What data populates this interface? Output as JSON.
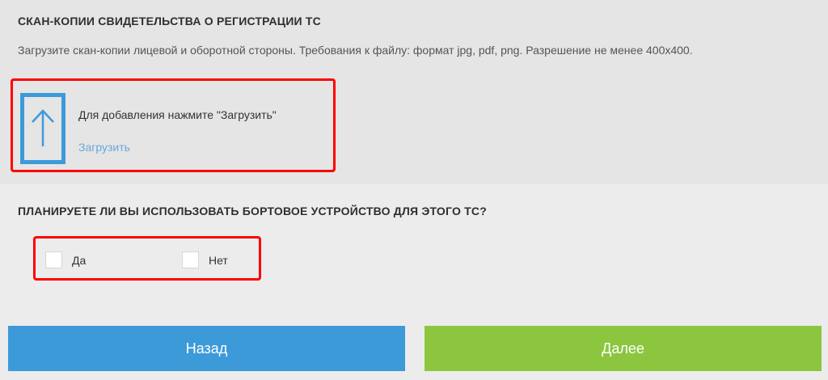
{
  "registration": {
    "title": "СКАН-КОПИИ СВИДЕТЕЛЬСТВА О РЕГИСТРАЦИИ ТС",
    "description": "Загрузите скан-копии лицевой и оборотной стороны. Требования к файлу: формат jpg, pdf, png. Разрешение не менее 400х400.",
    "upload_hint": "Для добавления нажмите \"Загрузить\"",
    "upload_link": "Загрузить",
    "upload_icon": "arrow-up-icon"
  },
  "onboard_device": {
    "question": "ПЛАНИРУЕТЕ ЛИ ВЫ ИСПОЛЬЗОВАТЬ БОРТОВОЕ УСТРОЙСТВО ДЛЯ ЭТОГО ТС?",
    "options": [
      {
        "label": "Да",
        "checked": false
      },
      {
        "label": "Нет",
        "checked": false
      }
    ]
  },
  "buttons": {
    "back": "Назад",
    "next": "Далее"
  },
  "colors": {
    "accent_blue": "#3d9ad9",
    "link_blue": "#6aa6dd",
    "next_green": "#8cc63f",
    "highlight_red": "#ff0000",
    "top_panel_bg": "#e5e5e5",
    "page_bg": "#ececec"
  }
}
